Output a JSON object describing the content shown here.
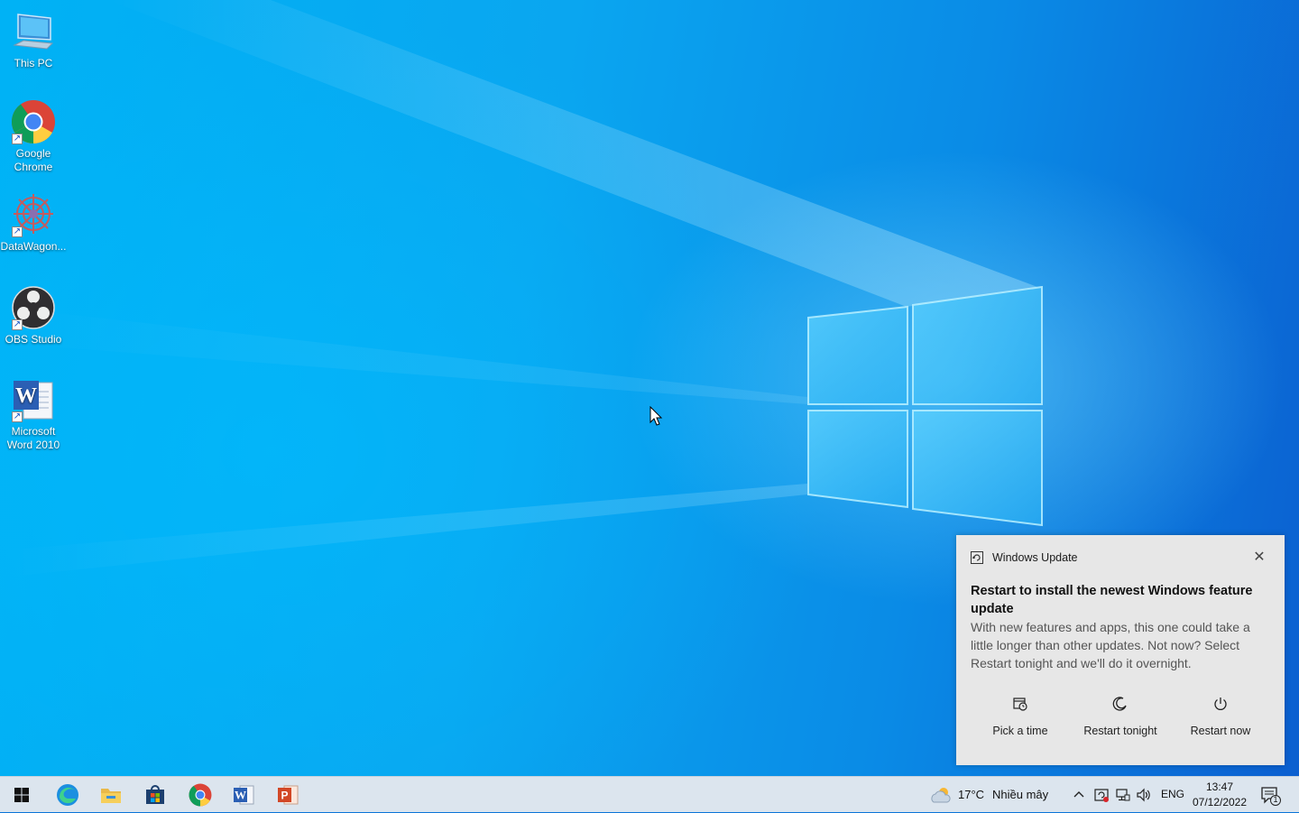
{
  "desktop": {
    "icons": [
      {
        "label": "This PC",
        "icon": "computer-icon"
      },
      {
        "label": "Google Chrome",
        "icon": "chrome-icon"
      },
      {
        "label": "DataWagon...",
        "icon": "datawagon-icon"
      },
      {
        "label": "OBS Studio",
        "icon": "obs-icon"
      },
      {
        "label": "Microsoft Word 2010",
        "icon": "word-icon"
      }
    ]
  },
  "toast": {
    "app_name": "Windows Update",
    "title": "Restart to install the newest Windows feature update",
    "body": "With new features and apps, this one could take a little longer than other updates. Not now? Select Restart tonight and we'll do it overnight.",
    "actions": [
      {
        "label": "Pick a time",
        "icon": "calendar-clock-icon"
      },
      {
        "label": "Restart tonight",
        "icon": "moon-icon"
      },
      {
        "label": "Restart now",
        "icon": "power-icon"
      }
    ],
    "close_icon": "close-icon"
  },
  "taskbar": {
    "apps": [
      "start-icon",
      "edge-icon",
      "file-explorer-icon",
      "store-icon",
      "chrome-icon",
      "word-icon",
      "powerpoint-icon"
    ],
    "weather": {
      "temp": "17°C",
      "condition": "Nhiều mây",
      "icon": "cloud-sun-icon"
    },
    "language": "ENG",
    "time": "13:47",
    "date": "07/12/2022",
    "notification_count": "1"
  },
  "colors": {
    "accent": "#0078d7",
    "taskbar": "#dce5ee",
    "toast_bg": "#e7e7e7"
  }
}
